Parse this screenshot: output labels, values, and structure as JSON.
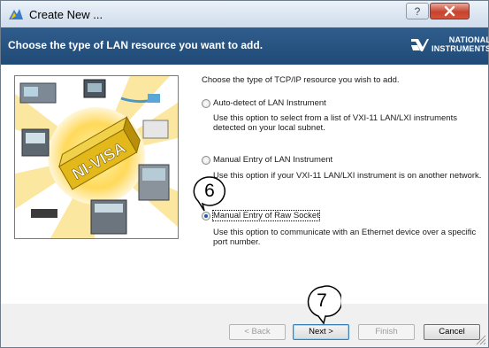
{
  "window": {
    "title": "Create New ...",
    "help_icon": "question-icon",
    "close_icon": "close-icon"
  },
  "header": {
    "title": "Choose the type of LAN resource you want to add.",
    "logo_line1": "NATIONAL",
    "logo_line2": "INSTRUMENTS"
  },
  "illustration": {
    "badge_text": "NI-VISA"
  },
  "prompt": "Choose the type of TCP/IP resource you wish to add.",
  "options": [
    {
      "label": "Auto-detect of LAN Instrument",
      "description": "Use this option to select from a list of VXI-11 LAN/LXI instruments detected on your local subnet.",
      "selected": false
    },
    {
      "label": "Manual Entry of LAN Instrument",
      "description": "Use this option if your VXI-11 LAN/LXI instrument is on another network.",
      "selected": false
    },
    {
      "label": "Manual Entry of Raw Socket",
      "description": "Use this option to communicate with an Ethernet device over a specific port number.",
      "selected": true
    }
  ],
  "callouts": [
    "6",
    "7"
  ],
  "buttons": {
    "back": "< Back",
    "next": "Next >",
    "finish": "Finish",
    "cancel": "Cancel"
  },
  "colors": {
    "header_bg": "#2a5683",
    "radio_dot": "#1e5aa8"
  }
}
